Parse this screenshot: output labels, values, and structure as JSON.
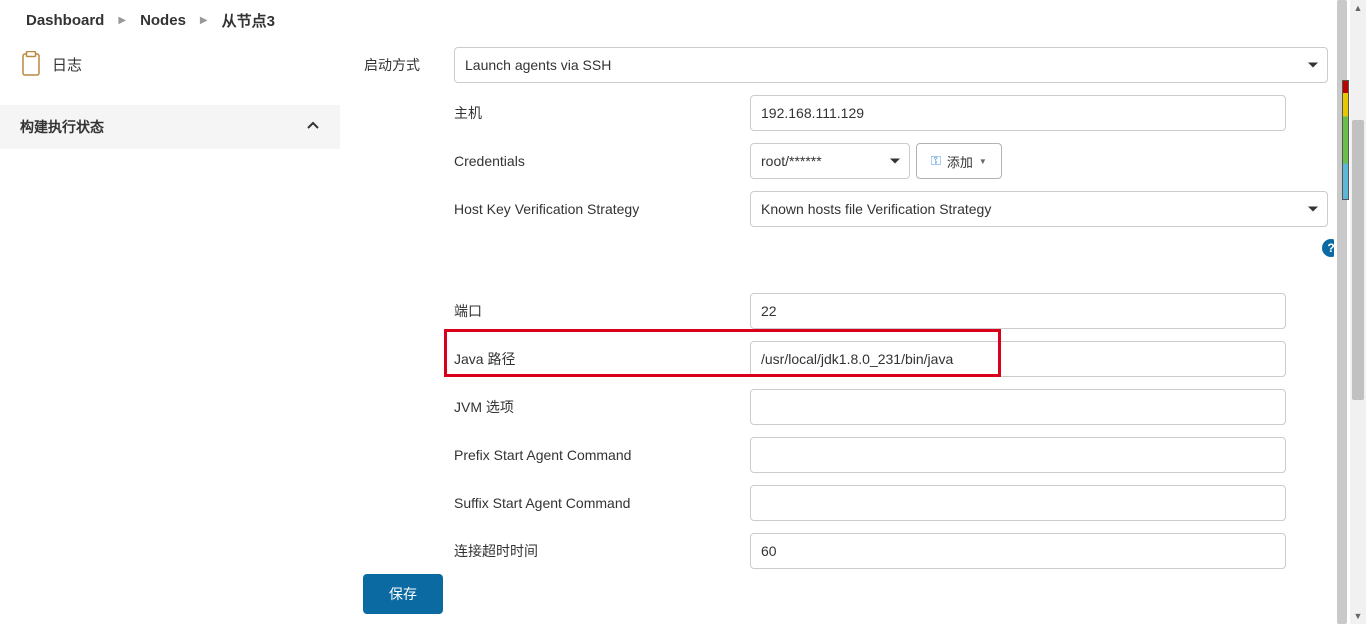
{
  "breadcrumb": {
    "dashboard": "Dashboard",
    "nodes": "Nodes",
    "node": "从节点3"
  },
  "sidebar": {
    "log_label": "日志",
    "build_status_label": "构建执行状态"
  },
  "form": {
    "launch_method": {
      "label": "启动方式",
      "value": "Launch agents via SSH"
    },
    "host": {
      "label": "主机",
      "value": "192.168.111.129"
    },
    "credentials": {
      "label": "Credentials",
      "value": "root/******",
      "add_label": "添加"
    },
    "host_key": {
      "label": "Host Key Verification Strategy",
      "value": "Known hosts file Verification Strategy"
    },
    "port": {
      "label": "端口",
      "value": "22"
    },
    "java_path": {
      "label": "Java 路径",
      "value": "/usr/local/jdk1.8.0_231/bin/java"
    },
    "jvm_options": {
      "label": "JVM 选项",
      "value": ""
    },
    "prefix_cmd": {
      "label": "Prefix Start Agent Command",
      "value": ""
    },
    "suffix_cmd": {
      "label": "Suffix Start Agent Command",
      "value": ""
    },
    "timeout": {
      "label": "连接超时时间",
      "value": "60"
    }
  },
  "buttons": {
    "save": "保存"
  }
}
